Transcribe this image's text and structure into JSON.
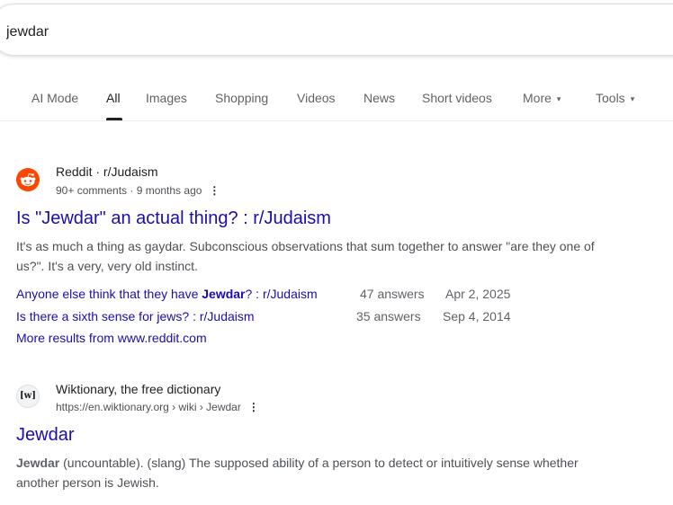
{
  "search": {
    "query": "jewdar"
  },
  "tabs": [
    {
      "label": "AI Mode"
    },
    {
      "label": "All"
    },
    {
      "label": "Images"
    },
    {
      "label": "Shopping"
    },
    {
      "label": "Videos"
    },
    {
      "label": "News"
    },
    {
      "label": "Short videos"
    },
    {
      "label": "More"
    },
    {
      "label": "Tools"
    }
  ],
  "results": [
    {
      "site_name": "Reddit · r/Judaism",
      "meta": "90+ comments · 9 months ago",
      "icon": "reddit-icon",
      "title": "Is \"Jewdar\" an actual thing? : r/Judaism",
      "snippet_line1": "It's as much a thing as gaydar. Subconscious observations that sum together to answer \"are they one of",
      "snippet_line2": "us?\". It's a very, very old instinct.",
      "sub_results": [
        {
          "title_pre": "Anyone else think that they have ",
          "title_bold": "Jewdar",
          "title_post": "? : r/Judaism",
          "answers": "47 answers",
          "date": "Apr 2, 2025"
        },
        {
          "title": "Is there a sixth sense for jews? : r/Judaism",
          "answers": "35 answers",
          "date": "Sep 4, 2014"
        }
      ],
      "more_results": "More results from www.reddit.com"
    },
    {
      "site_name": "Wiktionary, the free dictionary",
      "meta": "https://en.wiktionary.org › wiki › Jewdar",
      "icon_text": "[w]",
      "title": "Jewdar",
      "snippet_bold": "Jewdar",
      "snippet_line1": " (uncountable). (slang) The supposed ability of a person to detect or intuitively sense whether",
      "snippet_line2": "another person is Jewish."
    }
  ],
  "colors": {
    "link": "#1a0dab",
    "reddit": "#ff4500",
    "text": "#202124",
    "muted": "#4d5156"
  }
}
